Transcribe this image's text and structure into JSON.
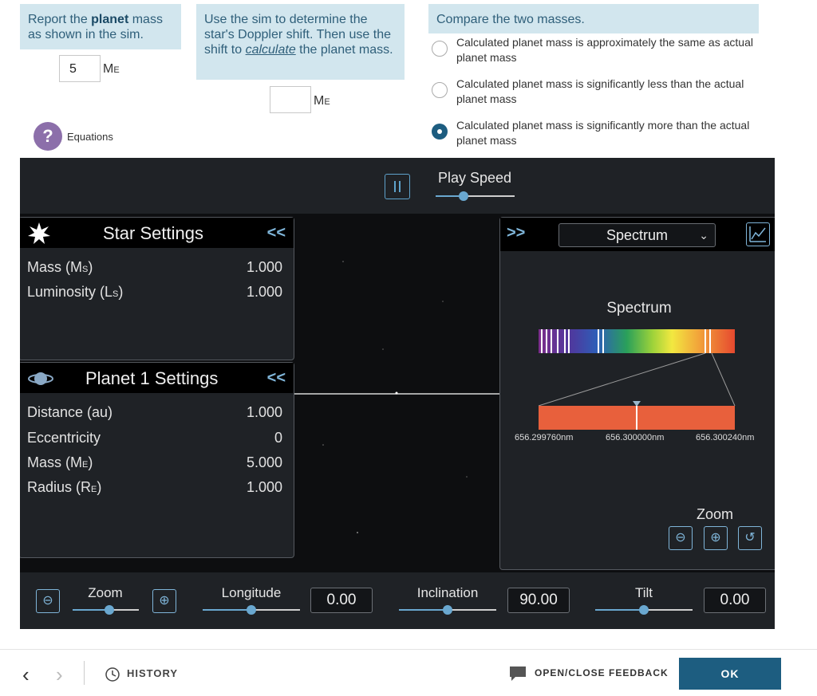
{
  "q1": {
    "prefix": "Report the ",
    "bold": "planet",
    "suffix": " mass as shown in the sim.",
    "value": "5",
    "unit": "M",
    "unit_sub": "E"
  },
  "q2": {
    "line1": "Use the sim to determine the star's Doppler shift. Then use the shift to ",
    "em": "calculate",
    "line2": " the planet mass.",
    "value": "",
    "unit": "M",
    "unit_sub": "E"
  },
  "q3": {
    "title": "Compare the two masses.",
    "options": [
      {
        "label": "Calculated planet mass is approximately the same as actual planet mass",
        "selected": false
      },
      {
        "label": "Calculated planet mass is significantly less than the actual planet mass",
        "selected": false
      },
      {
        "label": "Calculated planet mass is significantly more than the actual planet mass",
        "selected": true
      }
    ]
  },
  "help": {
    "icon": "?",
    "label": "Equations"
  },
  "sim": {
    "play_speed_label": "Play Speed",
    "play_speed_fraction": 0.35,
    "star_panel": {
      "title": "Star Settings",
      "collapse": "<<",
      "rows": [
        {
          "label": "Mass (M",
          "sub": "S",
          "close": ")",
          "value": "1.000"
        },
        {
          "label": "Luminosity (L",
          "sub": "S",
          "close": ")",
          "value": "1.000"
        }
      ]
    },
    "planet_panel": {
      "title": "Planet 1 Settings",
      "collapse": "<<",
      "rows": [
        {
          "label": "Distance (au)",
          "sub": "",
          "close": "",
          "value": "1.000"
        },
        {
          "label": "Eccentricity",
          "sub": "",
          "close": "",
          "value": "0"
        },
        {
          "label": "Mass (M",
          "sub": "E",
          "close": ")",
          "value": "5.000"
        },
        {
          "label": "Radius (R",
          "sub": "E",
          "close": ")",
          "value": "1.000"
        }
      ]
    },
    "spectrum_panel": {
      "expand": ">>",
      "select_value": "Spectrum",
      "title": "Spectrum",
      "nm_left": "656.299760nm",
      "nm_center": "656.300000nm",
      "nm_right": "656.300240nm",
      "zoom_label": "Zoom"
    },
    "bottom": {
      "zoom_label": "Zoom",
      "zoom_fraction": 0.55,
      "longitude_label": "Longitude",
      "longitude_value": "0.00",
      "longitude_fraction": 0.5,
      "inclination_label": "Inclination",
      "inclination_value": "90.00",
      "inclination_fraction": 0.5,
      "tilt_label": "Tilt",
      "tilt_value": "0.00",
      "tilt_fraction": 0.5
    }
  },
  "footer": {
    "history": "HISTORY",
    "feedback": "OPEN/CLOSE FEEDBACK",
    "ok": "OK"
  },
  "colors": {
    "accent": "#1d5d80",
    "slider": "#6aa8d0",
    "question_bg": "#d2e6ee"
  }
}
